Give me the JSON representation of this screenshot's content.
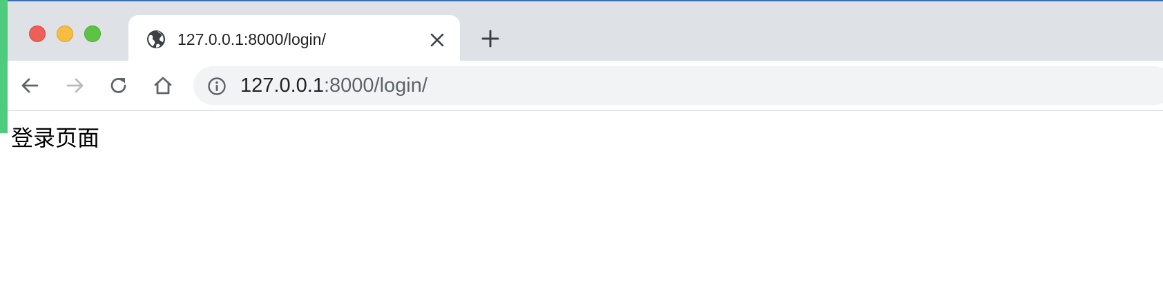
{
  "window": {
    "traffic_lights": [
      "close",
      "minimize",
      "maximize"
    ]
  },
  "tab": {
    "favicon": "globe-icon",
    "title": "127.0.0.1:8000/login/",
    "close_icon": "close-icon"
  },
  "new_tab": {
    "icon": "plus-icon"
  },
  "toolbar": {
    "back_icon": "arrow-left-icon",
    "forward_icon": "arrow-right-icon",
    "reload_icon": "reload-icon",
    "home_icon": "home-icon",
    "site_info_icon": "info-icon",
    "url_host": "127.0.0.1",
    "url_rest": ":8000/login/"
  },
  "page": {
    "heading": "登录页面"
  },
  "colors": {
    "titlebar": "#dee1e6",
    "omnibox": "#f1f3f4",
    "side_strip": "#4ecb7c",
    "close_light": "#ee5f57",
    "minimize_light": "#f6bd40",
    "maximize_light": "#5dc443"
  }
}
